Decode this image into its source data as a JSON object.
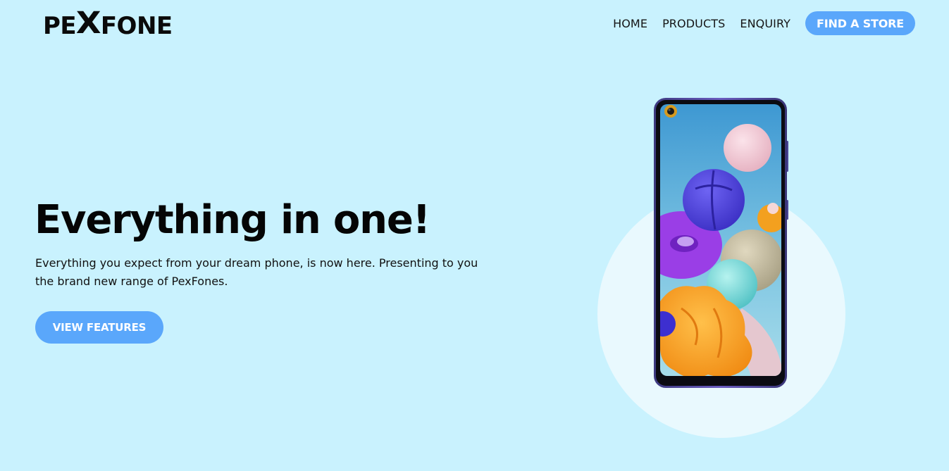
{
  "colors": {
    "page_background": "#c9f2fe",
    "accent": "#5aa7fb",
    "circle": "#e9f9fe"
  },
  "header": {
    "logo": {
      "before": "PE",
      "x_mark": "X",
      "after": "FONE"
    },
    "nav": [
      {
        "label": "HOME"
      },
      {
        "label": "PRODUCTS"
      },
      {
        "label": "ENQUIRY"
      }
    ],
    "cta_label": "FIND A STORE"
  },
  "hero": {
    "title": "Everything in one!",
    "description": "Everything you expect from your dream phone, is now here. Presenting to you the brand new range of PexFones.",
    "button_label": "VIEW FEATURES"
  },
  "illustration": {
    "icon": "smartphone-icon"
  }
}
